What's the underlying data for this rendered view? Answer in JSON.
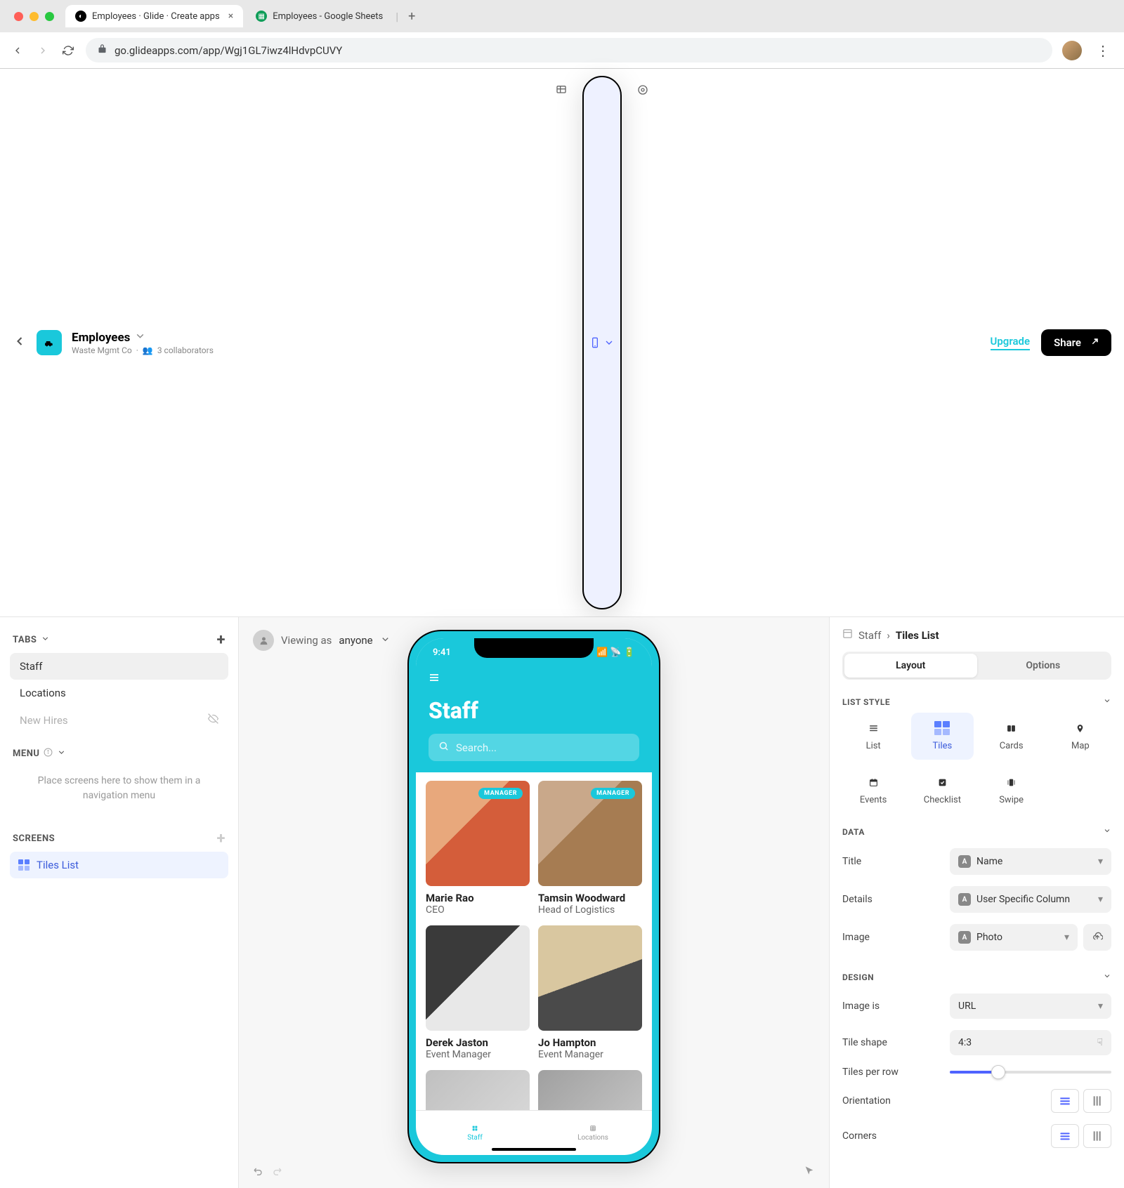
{
  "browser": {
    "tabs": [
      {
        "label": "Employees · Glide · Create apps",
        "icon_bg": "#000"
      },
      {
        "label": "Employees - Google Sheets",
        "icon_bg": "#0f9d58"
      }
    ],
    "url": "go.glideapps.com/app/Wgj1GL7iwz4lHdvpCUVY"
  },
  "app_header": {
    "title": "Employees",
    "org": "Waste Mgmt Co",
    "collaborators": "3 collaborators",
    "upgrade": "Upgrade",
    "share": "Share"
  },
  "left_panel": {
    "tabs_label": "TABS",
    "tabs": [
      {
        "label": "Staff",
        "active": true
      },
      {
        "label": "Locations",
        "active": false
      },
      {
        "label": "New Hires",
        "muted": true
      }
    ],
    "menu_label": "MENU",
    "menu_placeholder": "Place screens here to show them in a navigation menu",
    "screens_label": "SCREENS",
    "screens": [
      {
        "label": "Tiles List"
      }
    ]
  },
  "canvas": {
    "viewing_as_label": "Viewing as",
    "viewing_as_value": "anyone"
  },
  "phone": {
    "time": "9:41",
    "title": "Staff",
    "search_placeholder": "Search...",
    "badge_manager": "MANAGER",
    "people": [
      {
        "name": "Marie Rao",
        "role": "CEO",
        "badge": true,
        "img": "p1"
      },
      {
        "name": "Tamsin Woodward",
        "role": "Head of Logistics",
        "badge": true,
        "img": "p2"
      },
      {
        "name": "Derek Jaston",
        "role": "Event Manager",
        "badge": false,
        "img": "p3"
      },
      {
        "name": "Jo Hampton",
        "role": "Event Manager",
        "badge": false,
        "img": "p4"
      }
    ],
    "bottom_tabs": [
      {
        "label": "Staff",
        "active": true
      },
      {
        "label": "Locations",
        "active": false
      }
    ]
  },
  "right_panel": {
    "breadcrumb_parent": "Staff",
    "breadcrumb_current": "Tiles List",
    "segments": {
      "layout": "Layout",
      "options": "Options"
    },
    "list_style_label": "LIST STYLE",
    "styles": [
      {
        "label": "List"
      },
      {
        "label": "Tiles",
        "active": true
      },
      {
        "label": "Cards"
      },
      {
        "label": "Map"
      },
      {
        "label": "Events"
      },
      {
        "label": "Checklist"
      },
      {
        "label": "Swipe"
      }
    ],
    "data_label": "DATA",
    "data_fields": {
      "title": {
        "label": "Title",
        "value": "Name"
      },
      "details": {
        "label": "Details",
        "value": "User Specific Column"
      },
      "image": {
        "label": "Image",
        "value": "Photo"
      }
    },
    "design_label": "DESIGN",
    "design_fields": {
      "image_is": {
        "label": "Image is",
        "value": "URL"
      },
      "tile_shape": {
        "label": "Tile shape",
        "value": "4:3"
      },
      "tiles_per_row": {
        "label": "Tiles per row"
      },
      "orientation": {
        "label": "Orientation"
      },
      "corners": {
        "label": "Corners"
      }
    }
  }
}
